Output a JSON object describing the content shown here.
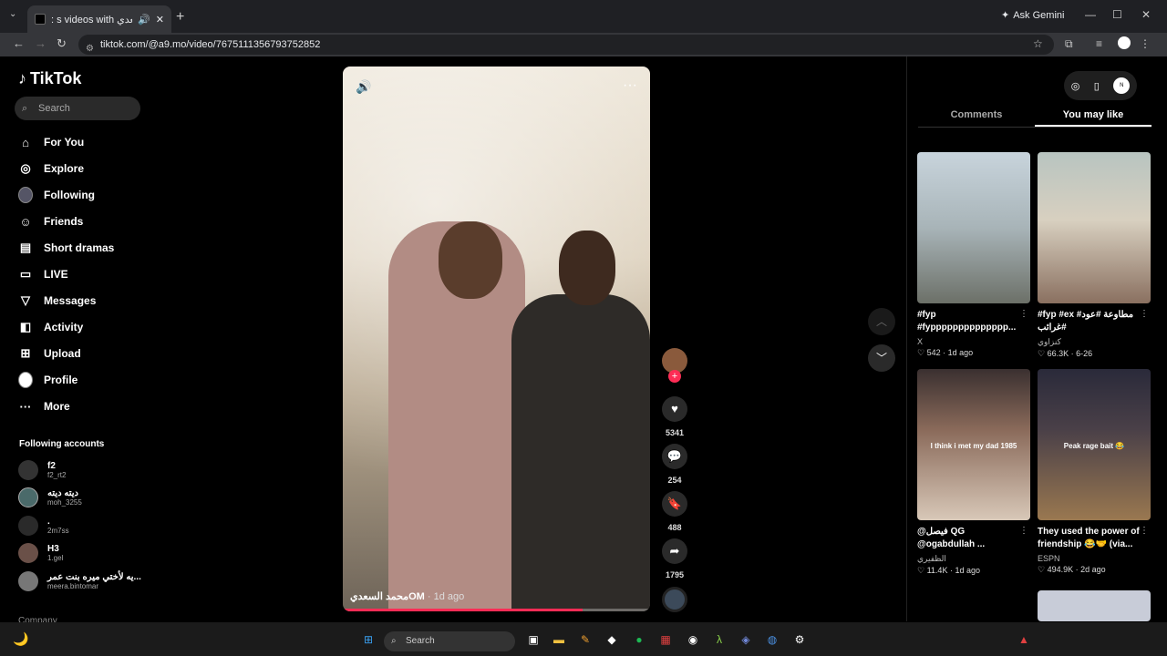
{
  "browser": {
    "tab_title": ": s videos with محمد السعدي",
    "new_tab": "+",
    "ask_gemini": "Ask Gemini",
    "url": "tiktok.com/@a9.mo/video/7675111356793752852",
    "window_controls": {
      "minimize": "—",
      "maximize": "☐",
      "close": "✕"
    }
  },
  "sidebar": {
    "logo": "TikTok",
    "search_placeholder": "Search",
    "nav": [
      {
        "label": "For You",
        "icon": "home-icon"
      },
      {
        "label": "Explore",
        "icon": "compass-icon"
      },
      {
        "label": "Following",
        "icon": "avatar-icon"
      },
      {
        "label": "Friends",
        "icon": "friends-icon"
      },
      {
        "label": "Short dramas",
        "icon": "film-icon"
      },
      {
        "label": "LIVE",
        "icon": "live-icon"
      },
      {
        "label": "Messages",
        "icon": "send-icon"
      },
      {
        "label": "Activity",
        "icon": "inbox-icon"
      },
      {
        "label": "Upload",
        "icon": "plus-square-icon"
      },
      {
        "label": "Profile",
        "icon": "avatar-icon"
      },
      {
        "label": "More",
        "icon": "ellipsis-icon"
      }
    ],
    "following_title": "Following accounts",
    "following": [
      {
        "name": "f2",
        "handle": "f2_rt2"
      },
      {
        "name": "ديته ديته",
        "handle": "moh_3255"
      },
      {
        "name": ".",
        "handle": "2m7ss"
      },
      {
        "name": "H3",
        "handle": "1.gel"
      },
      {
        "name": "يه لأختي ميره بنت عمر...",
        "handle": "meera.bintomar"
      }
    ],
    "company": "Company"
  },
  "video": {
    "caption_author": "محمد السعديOM",
    "caption_time": "· 1d ago",
    "progress": 0.78
  },
  "actions": {
    "likes": "5341",
    "comments": "254",
    "saves": "488",
    "shares": "1795"
  },
  "right_panel": {
    "tabs": [
      "Comments",
      "You may like"
    ],
    "active_tab": 1,
    "cards": [
      {
        "title": "#fyp #fypppppppppppppp...",
        "author": "X",
        "likes": "542",
        "date": "1d ago",
        "overlay": ""
      },
      {
        "title": "#fyp #ex #مطاوعة #عود #غرائب",
        "author": "كنزاوي",
        "likes": "66.3K",
        "date": "6-26",
        "overlay": ""
      },
      {
        "title": "@فيصل QG @ogabdullah ...",
        "author": "الظفيري",
        "likes": "11.4K",
        "date": "1d ago",
        "overlay": "I think i met my dad 1985"
      },
      {
        "title": "They used the power of friendship 😂🤝 (via...",
        "author": "ESPN",
        "likes": "494.9K",
        "date": "2d ago",
        "overlay": "Peak rage bait 😂"
      }
    ]
  },
  "taskbar": {
    "search_placeholder": "Search"
  }
}
